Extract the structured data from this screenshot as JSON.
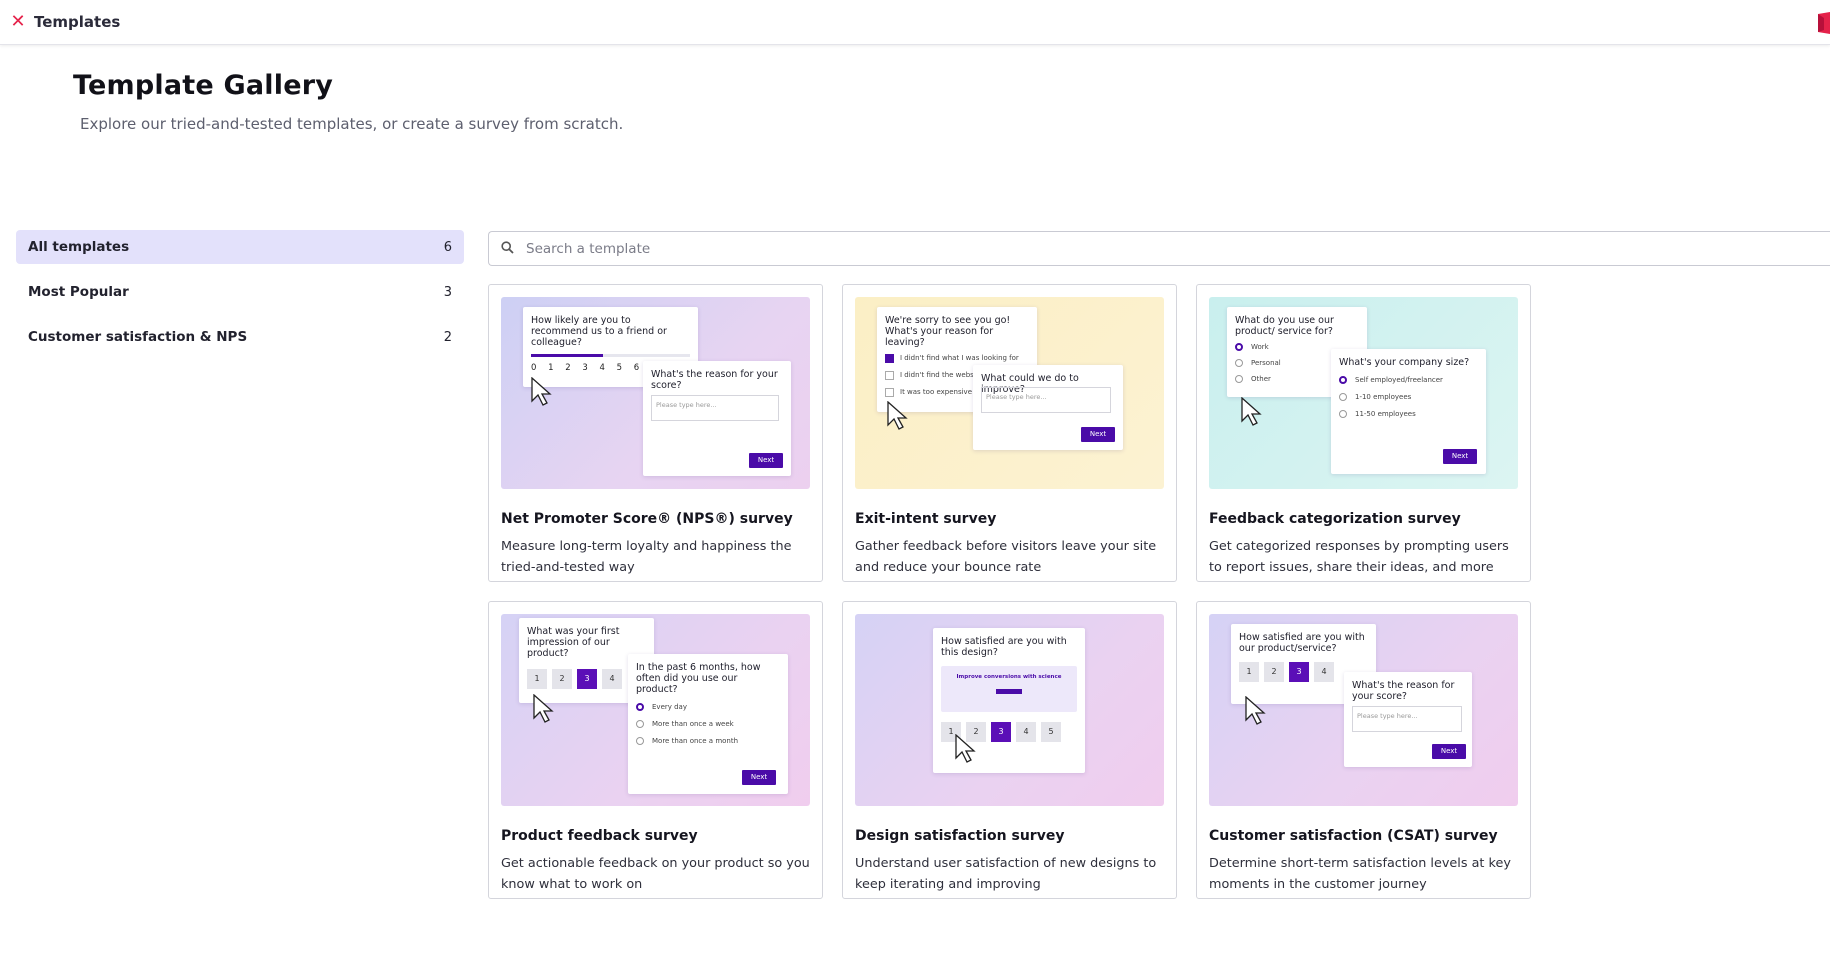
{
  "topbar": {
    "close_icon": "close-icon",
    "title": "Templates",
    "brand_color": "#e5224a"
  },
  "hero": {
    "title": "Template Gallery",
    "subtitle": "Explore our tried-and-tested templates, or create a survey from scratch."
  },
  "sidebar": {
    "items": [
      {
        "label": "All templates",
        "count": "6",
        "active": true
      },
      {
        "label": "Most Popular",
        "count": "3",
        "active": false
      },
      {
        "label": "Customer satisfaction & NPS",
        "count": "2",
        "active": false
      }
    ]
  },
  "search": {
    "placeholder": "Search a template",
    "icon": "search-icon"
  },
  "cards": [
    {
      "title": "Net Promoter Score® (NPS®) survey",
      "desc": "Measure long-term loyalty and happiness the tried-and-tested way"
    },
    {
      "title": "Exit-intent survey",
      "desc": "Gather feedback before visitors leave your site and reduce your bounce rate"
    },
    {
      "title": "Feedback categorization survey",
      "desc": "Get categorized responses by prompting users to report issues, share their ideas, and more"
    },
    {
      "title": "Product feedback survey",
      "desc": "Get actionable feedback on your product so you know what to work on"
    },
    {
      "title": "Design satisfaction survey",
      "desc": "Understand user satisfaction of new designs to keep iterating and improving"
    },
    {
      "title": "Customer satisfaction (CSAT) survey",
      "desc": "Determine short-term satisfaction levels at key moments in the customer journey"
    }
  ],
  "thumbs": {
    "nps": {
      "q1": "How likely are you to recommend us to a friend or colleague?",
      "scale": [
        "0",
        "1",
        "2",
        "3",
        "4",
        "5",
        "6"
      ],
      "q2": "What's the reason for your score?",
      "placeholder": "Please type here...",
      "next": "Next"
    },
    "exit": {
      "q1": "We're sorry to see you go! What's your reason for leaving?",
      "options": [
        "I didn't find what I was looking for",
        "I didn't find the website easy to use",
        "It was too expensive for me"
      ],
      "q2": "What could we do to improve?",
      "placeholder": "Please type here...",
      "next": "Next"
    },
    "categorization": {
      "q1": "What do you use our product/ service for?",
      "options1": [
        "Work",
        "Personal",
        "Other"
      ],
      "q2": "What's your company size?",
      "options2": [
        "Self employed/freelancer",
        "1-10 employees",
        "11-50 employees"
      ],
      "next": "Next"
    },
    "product": {
      "q1": "What was your first impression of our product?",
      "scale": [
        "1",
        "2",
        "3",
        "4"
      ],
      "q2": "In the past 6 months, how often did you use our product?",
      "options": [
        "Every day",
        "More than once a week",
        "More than once a month"
      ],
      "next": "Next"
    },
    "design": {
      "q1": "How satisfied are you with this design?",
      "banner": "Improve conversions with science",
      "scale": [
        "1",
        "2",
        "3",
        "4",
        "5"
      ]
    },
    "csat": {
      "q1": "How satisfied are you with our product/service?",
      "scale": [
        "1",
        "2",
        "3",
        "4"
      ],
      "q2": "What's the reason for your score?",
      "placeholder": "Please type here...",
      "next": "Next"
    }
  }
}
